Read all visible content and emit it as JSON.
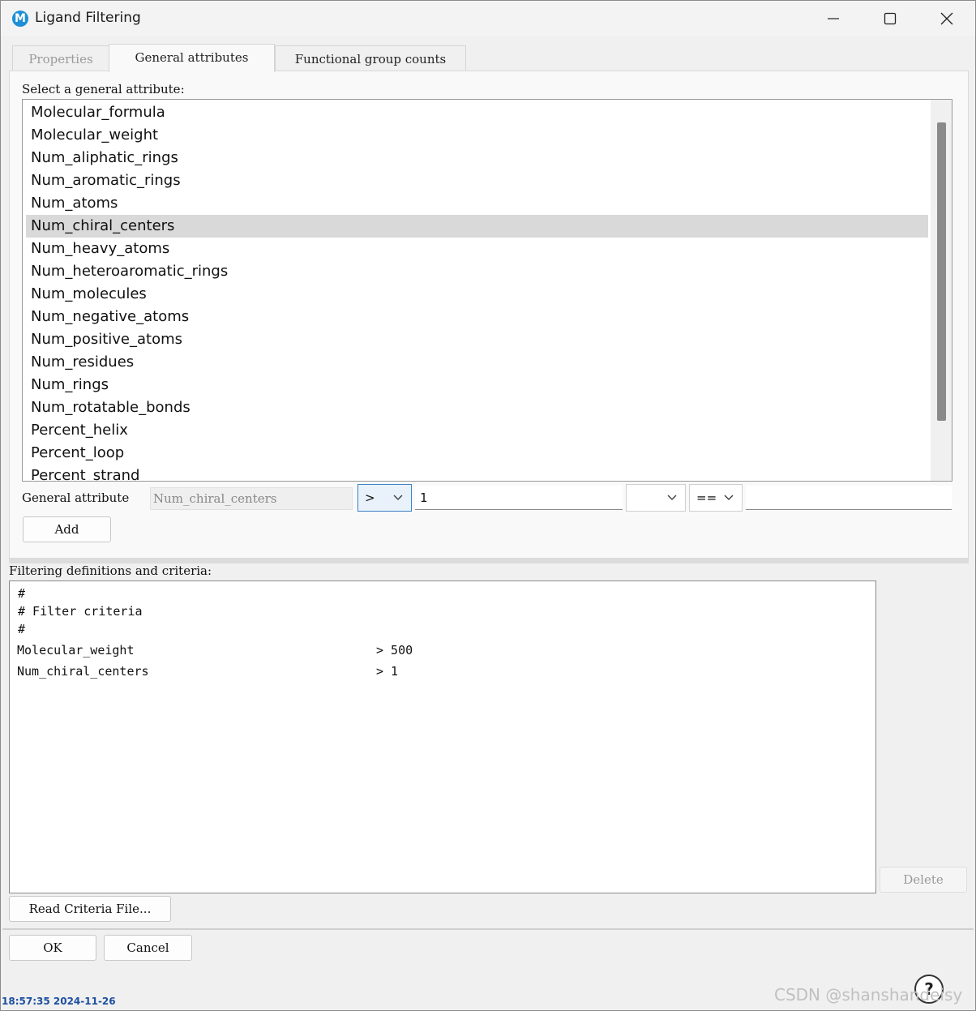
{
  "window": {
    "title": "Ligand Filtering",
    "app_icon_letter": "M"
  },
  "tabs": [
    {
      "label": "Properties",
      "state": "disabled"
    },
    {
      "label": "General attributes",
      "state": "active"
    },
    {
      "label": "Functional group counts",
      "state": "normal"
    }
  ],
  "general": {
    "select_label": "Select a general attribute:",
    "attributes": [
      "Molecular_formula",
      "Molecular_weight",
      "Num_aliphatic_rings",
      "Num_aromatic_rings",
      "Num_atoms",
      "Num_chiral_centers",
      "Num_heavy_atoms",
      "Num_heteroaromatic_rings",
      "Num_molecules",
      "Num_negative_atoms",
      "Num_positive_atoms",
      "Num_residues",
      "Num_rings",
      "Num_rotatable_bonds",
      "Percent_helix",
      "Percent_loop",
      "Percent_strand"
    ],
    "selected": "Num_chiral_centers",
    "criterion": {
      "label": "General attribute",
      "attribute_value": "Num_chiral_centers",
      "operator1": ">",
      "value1": "1",
      "logical_op": "",
      "operator2": "==",
      "value2": ""
    },
    "add_label": "Add"
  },
  "filtering": {
    "label": "Filtering definitions and criteria:",
    "lines": [
      {
        "text": "#"
      },
      {
        "text": "# Filter criteria"
      },
      {
        "text": "#"
      },
      {
        "name": "Molecular_weight",
        "expr": "> 500"
      },
      {
        "name": "Num_chiral_centers",
        "expr": "> 1"
      }
    ],
    "delete_label": "Delete",
    "read_file_label": "Read Criteria File..."
  },
  "footer": {
    "ok_label": "OK",
    "cancel_label": "Cancel",
    "help_label": "?"
  },
  "overlay": {
    "timestamp": "18:57:35 2024-11-26",
    "watermark": "CSDN @shanshandeisy"
  },
  "colors": {
    "accent": "#3b7fc4",
    "selection": "#d9d9d9",
    "app_icon": "#1e8fd6"
  }
}
